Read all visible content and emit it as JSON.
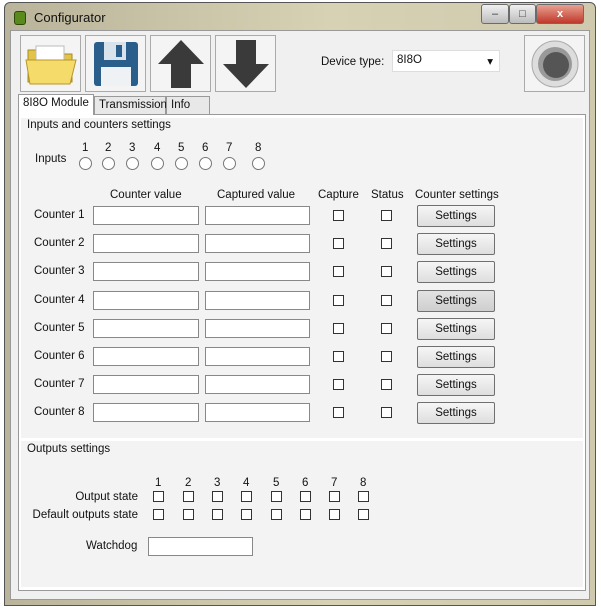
{
  "window": {
    "title": "Configurator",
    "minimize": "–",
    "maximize": "□",
    "close": "x"
  },
  "toolbar": {
    "device_type_label": "Device type:",
    "device_type_value": "8I8O",
    "dropdown_arrow": "▾"
  },
  "tabs": [
    {
      "label": "8I8O Module"
    },
    {
      "label": "Transmission"
    },
    {
      "label": "Info"
    }
  ],
  "inputs_group": {
    "title": "Inputs and counters settings",
    "inputs_label": "Inputs",
    "input_numbers": [
      "1",
      "2",
      "3",
      "4",
      "5",
      "6",
      "7",
      "8"
    ]
  },
  "columns": {
    "counter_value": "Counter value",
    "captured_value": "Captured value",
    "capture": "Capture",
    "status": "Status",
    "counter_settings": "Counter settings"
  },
  "counters": [
    {
      "label": "Counter 1",
      "button": "Settings"
    },
    {
      "label": "Counter 2",
      "button": "Settings"
    },
    {
      "label": "Counter 3",
      "button": "Settings"
    },
    {
      "label": "Counter 4",
      "button": "Settings"
    },
    {
      "label": "Counter 5",
      "button": "Settings"
    },
    {
      "label": "Counter 6",
      "button": "Settings"
    },
    {
      "label": "Counter 7",
      "button": "Settings"
    },
    {
      "label": "Counter 8",
      "button": "Settings"
    }
  ],
  "outputs_group": {
    "title": "Outputs settings",
    "output_numbers": [
      "1",
      "2",
      "3",
      "4",
      "5",
      "6",
      "7",
      "8"
    ],
    "output_state_label": "Output state",
    "default_state_label": "Default outputs state",
    "watchdog_label": "Watchdog"
  }
}
